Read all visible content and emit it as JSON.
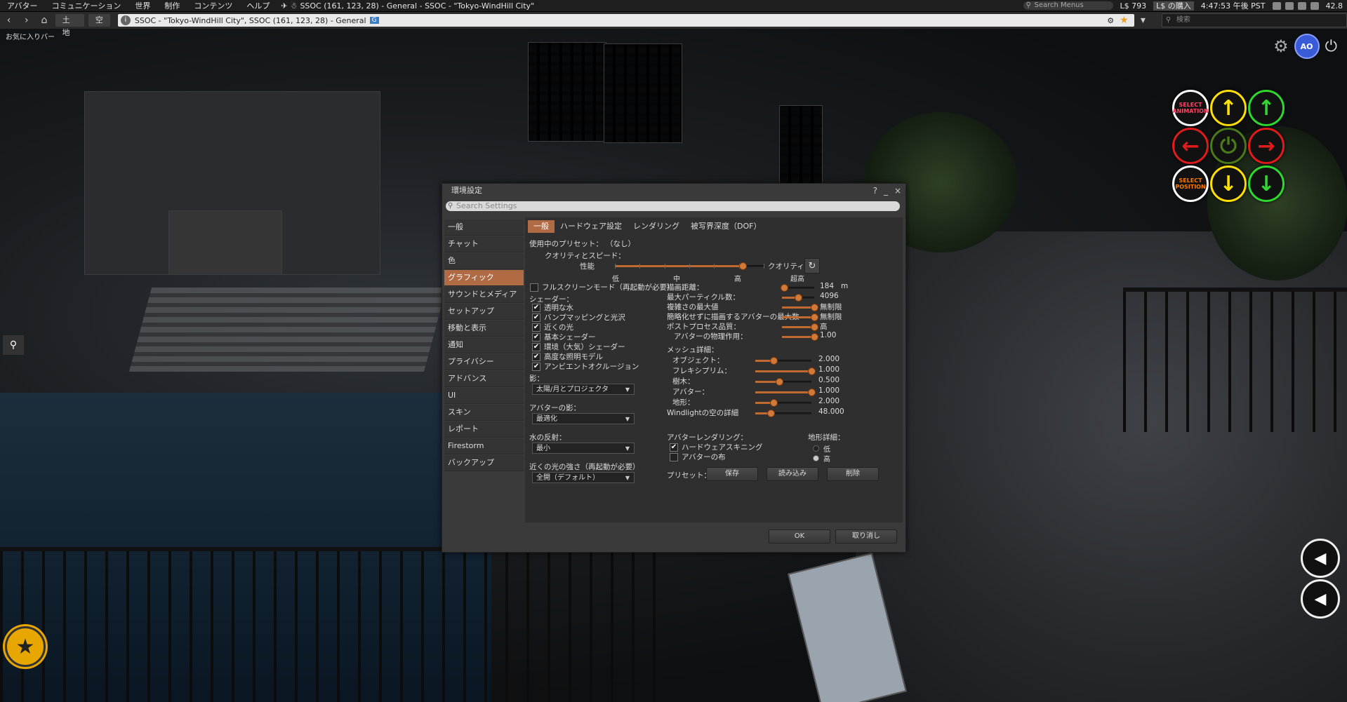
{
  "menubar": {
    "items": [
      "アバター",
      "コミュニケーション",
      "世界",
      "制作",
      "コンテンツ",
      "ヘルプ"
    ],
    "location": "SSOC (161, 123, 28) - General - SSOC - \"Tokyo-WindHill City\"",
    "search_placeholder": "Search Menus",
    "balance": "L$ 793",
    "buy": "L$ の購入",
    "time": "4:47:53 午後 PST",
    "fps": "42.8"
  },
  "navbar": {
    "land": "土地",
    "sky": "空",
    "url": "SSOC - \"Tokyo-WindHill City\", SSOC (161, 123, 28) - General",
    "url_badge": "G",
    "search_placeholder": "検索"
  },
  "favorites_label": "お気に入りバー",
  "hud": {
    "select_animation": "SELECT ANIMATION",
    "select_position": "SELECT POSITION",
    "ao": "AO"
  },
  "dialog": {
    "title": "環境設定",
    "help": "?",
    "minimize": "_",
    "close": "×",
    "search_placeholder": "Search Settings",
    "categories": [
      "一般",
      "チャット",
      "色",
      "グラフィック",
      "サウンドとメディア",
      "セットアップ",
      "移動と表示",
      "通知",
      "プライバシー",
      "アドバンス",
      "UI",
      "スキン",
      "レポート",
      "Firestorm",
      "バックアップ"
    ],
    "active_category": 3,
    "tabs": [
      "一般",
      "ハードウェア設定",
      "レンダリング",
      "被写界深度（DOF）"
    ],
    "active_tab": 0,
    "preset_in_use_label": "使用中のプリセット：",
    "preset_in_use_value": "（なし）",
    "quality_label": "クオリティとスピード：",
    "quality_left": "性能",
    "quality_right": "クオリティ",
    "quality_ticks": [
      "低",
      "中",
      "高",
      "超高"
    ],
    "quality_level": 0.86,
    "fullscreen": {
      "label": "フルスクリーンモード（再起動が必要）",
      "checked": false
    },
    "shaders_label": "シェーダー：",
    "shaders": [
      {
        "label": "透明な水",
        "checked": true
      },
      {
        "label": "バンプマッピングと光沢",
        "checked": true
      },
      {
        "label": "近くの光",
        "checked": true
      },
      {
        "label": "基本シェーダー",
        "checked": true
      },
      {
        "label": "環境（大気）シェーダー",
        "checked": true
      },
      {
        "label": "高度な照明モデル",
        "checked": true
      },
      {
        "label": "アンビエントオクルージョン",
        "checked": true
      }
    ],
    "shadows_label": "影：",
    "shadows_value": "太陽/月とプロジェクタ",
    "avatar_shadow_label": "アバターの影：",
    "avatar_shadow_value": "最適化",
    "water_reflect_label": "水の反射：",
    "water_reflect_value": "最小",
    "nearlight_label": "近くの光の強さ（再起動が必要）",
    "nearlight_value": "全開（デフォルト）",
    "right_sliders": [
      {
        "label": "描画距離：",
        "value": "184",
        "unit": "m",
        "level": 0.07
      },
      {
        "label": "最大パーティクル数：",
        "value": "4096",
        "unit": "",
        "level": 0.5
      },
      {
        "label": "複雑さの最大値",
        "value": "無制限",
        "unit": "",
        "level": 1.0
      },
      {
        "label": "簡略化せずに描画するアバターの最大数",
        "value": "無制限",
        "unit": "",
        "level": 1.0
      },
      {
        "label": "ポストプロセス品質：",
        "value": "高",
        "unit": "",
        "level": 1.0
      },
      {
        "label": "アバターの物理作用：",
        "value": "1.00",
        "unit": "",
        "level": 1.0
      }
    ],
    "mesh_label": "メッシュ詳細：",
    "mesh_sliders": [
      {
        "label": "オブジェクト：",
        "value": "2.000",
        "level": 0.33
      },
      {
        "label": "フレキシプリム：",
        "value": "1.000",
        "level": 1.0
      },
      {
        "label": "樹木：",
        "value": "0.500",
        "level": 0.42
      },
      {
        "label": "アバター：",
        "value": "1.000",
        "level": 1.0
      },
      {
        "label": "地形：",
        "value": "2.000",
        "level": 0.33
      },
      {
        "label": "Windlightの空の詳細",
        "value": "48.000",
        "level": 0.27
      }
    ],
    "avatar_render_label": "アバターレンダリング：",
    "avatar_render": [
      {
        "label": "ハードウェアスキニング",
        "checked": true
      },
      {
        "label": "アバターの布",
        "checked": false
      }
    ],
    "terrain_detail_label": "地形詳細：",
    "terrain_options": [
      {
        "label": "低",
        "selected": false
      },
      {
        "label": "高",
        "selected": true
      }
    ],
    "preset_label": "プリセット：",
    "save": "保存",
    "load": "読み込み",
    "delete": "削除",
    "ok": "OK",
    "cancel": "取り消し"
  },
  "colors": {
    "accent": "#b06b45",
    "slider": "#c06a30",
    "dialog_bg": "#3a3a3a"
  }
}
